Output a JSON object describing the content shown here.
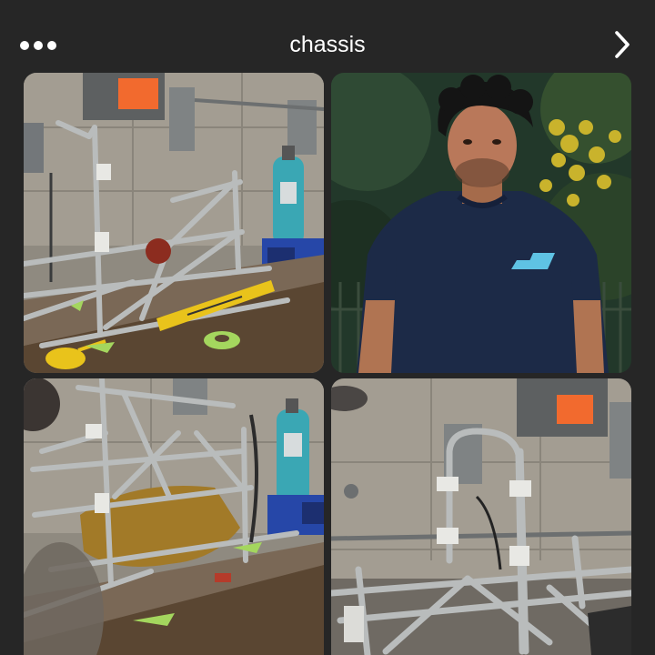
{
  "header": {
    "title": "chassis",
    "more_icon": "more-horizontal-icon",
    "next_icon": "chevron-right-icon"
  },
  "photos": [
    {
      "subject": "chassis-frame-workshop-bench"
    },
    {
      "subject": "team-member-portrait"
    },
    {
      "subject": "chassis-frame-angled-view"
    },
    {
      "subject": "chassis-frame-closeup"
    }
  ],
  "colors": {
    "background": "#262626",
    "title_text": "#ffffff",
    "safety_label": "#f26a2e",
    "cylinder_teal": "#3aa7b4",
    "level_yellow": "#e9c31b"
  }
}
